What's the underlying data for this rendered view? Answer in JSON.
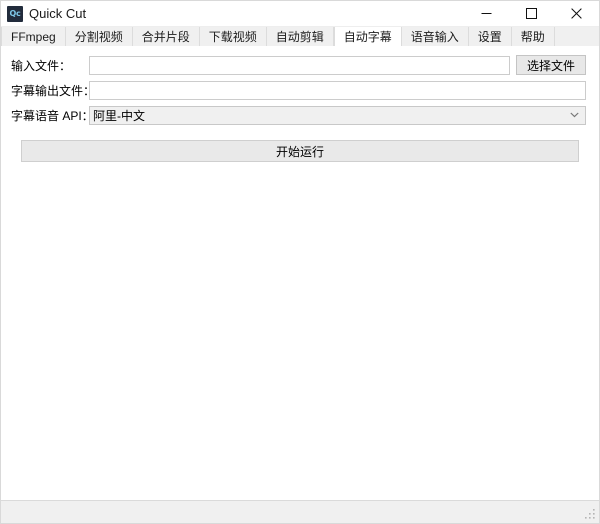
{
  "window": {
    "title": "Quick Cut",
    "icon_label": "Qc",
    "icon_name": "app-icon",
    "controls": {
      "minimize": "minimize-icon",
      "maximize": "maximize-icon",
      "close": "close-icon"
    }
  },
  "tabs": [
    {
      "label": "FFmpeg",
      "active": false
    },
    {
      "label": "分割视频",
      "active": false
    },
    {
      "label": "合并片段",
      "active": false
    },
    {
      "label": "下载视频",
      "active": false
    },
    {
      "label": "自动剪辑",
      "active": false
    },
    {
      "label": "自动字幕",
      "active": true
    },
    {
      "label": "语音输入",
      "active": false
    },
    {
      "label": "设置",
      "active": false
    },
    {
      "label": "帮助",
      "active": false
    }
  ],
  "form": {
    "input_file": {
      "label": "输入文件：",
      "value": "",
      "placeholder": ""
    },
    "output_file": {
      "label": "字幕输出文件：",
      "value": "",
      "placeholder": ""
    },
    "api": {
      "label": "字幕语音 API：",
      "value": "阿里-中文",
      "arrow_icon": "chevron-down-icon"
    },
    "choose_file_button": "选择文件",
    "run_button": "开始运行"
  },
  "statusbar": {
    "text": "",
    "grip_icon": "resize-grip-icon"
  },
  "colors": {
    "accent": "#222c3c",
    "icon_text": "#7ec8e8",
    "tabbar_bg": "#f0f0f0",
    "content_bg": "#ffffff",
    "button_bg": "#e8e8e8",
    "border": "#cccccc"
  }
}
